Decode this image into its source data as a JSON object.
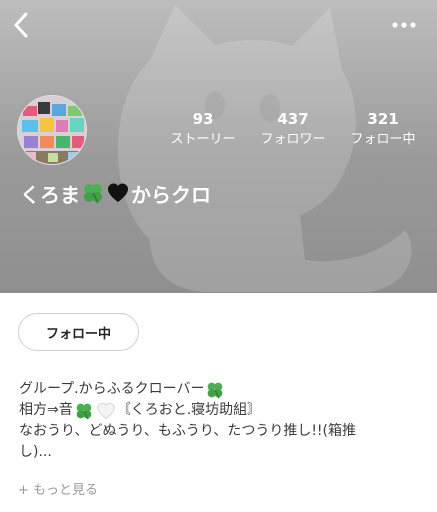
{
  "header": {
    "back_icon": "chevron-left-icon",
    "more_icon": "more-horizontal-icon"
  },
  "profile": {
    "name_part1": "くろま",
    "name_part2": "からクロ",
    "name_emojis": [
      "four-leaf-clover-icon",
      "black-heart-icon"
    ]
  },
  "stats": [
    {
      "value": "93",
      "label": "ストーリー"
    },
    {
      "value": "437",
      "label": "フォロワー"
    },
    {
      "value": "321",
      "label": "フォロー中"
    }
  ],
  "follow_button": {
    "label": "フォロー中"
  },
  "bio": {
    "line1": "グループ.からふるクローバー",
    "line2_a": "相方⇒音",
    "line2_b": "〘くろおと.寝坊助組〙",
    "line3": "なおうり、どぬうり、もふうり、たつうり推し!!(箱推",
    "line4": "し)..."
  },
  "more_link": {
    "label": "+ もっと見る"
  },
  "colors": {
    "header_top": "#bdbdbd",
    "header_bottom": "#8f8f8f",
    "clover_green": "#4caf50",
    "text_dark": "#3b3b3b",
    "text_muted": "#9a9a9a"
  }
}
